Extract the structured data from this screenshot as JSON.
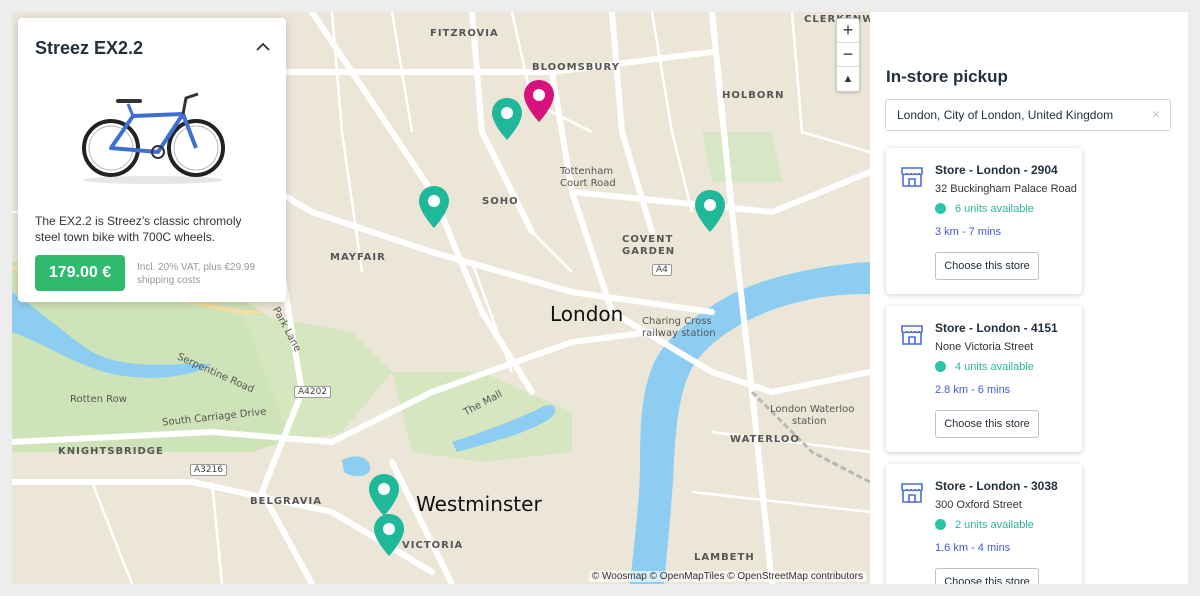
{
  "product": {
    "title": "Streez EX2.2",
    "description": "The EX2.2 is Streez’s classic chromoly steel town bike with 700C wheels.",
    "price": "179.00 €",
    "price_note": "Incl. 20% VAT, plus €29.99 shipping costs",
    "collapse_icon": "chevron-up-icon"
  },
  "map": {
    "zoom_in": "+",
    "zoom_out": "−",
    "reset_north": "▲",
    "attribution": "© Woosmap © OpenMapTiles © OpenStreetMap contributors",
    "labels": {
      "fitzrovia": "FITZROVIA",
      "bloomsbury": "BLOOMSBURY",
      "holborn": "HOLBORN",
      "clerkenwell": "CLERKENWELL",
      "soho": "SOHO",
      "mayfair": "MAYFAIR",
      "covent_garden_1": "COVENT",
      "covent_garden_2": "GARDEN",
      "tottenham_1": "Tottenham",
      "tottenham_2": "Court Road",
      "london": "London",
      "charing_1": "Charing Cross",
      "charing_2": "railway station",
      "park_lane": "Park Lane",
      "serpentine": "Serpentine Road",
      "rotten_row": "Rotten Row",
      "south_carriage": "South Carriage Drive",
      "the_mall": "The Mall",
      "knightsbridge": "KNIGHTSBRIDGE",
      "belgravia": "BELGRAVIA",
      "westminster": "Westminster",
      "victoria": "VICTORIA",
      "lambeth": "LAMBETH",
      "waterloo": "WATERLOO",
      "waterloo_st_1": "London Waterloo",
      "waterloo_st_2": "station",
      "a4": "A4",
      "a4202": "A4202",
      "a3216": "A3216"
    },
    "pin_colors": {
      "store": "#1fb99a",
      "selected": "#d6127f"
    }
  },
  "pickup": {
    "title": "In-store pickup",
    "search_value": "London, City of London, United Kingdom",
    "clear_label": "×",
    "stores": [
      {
        "name": "Store - London - 2904",
        "address": "32 Buckingham Palace Road",
        "stock": "6 units available",
        "distance": "3 km - 7 mins",
        "button": "Choose this store"
      },
      {
        "name": "Store - London - 4151",
        "address": "None Victoria Street",
        "stock": "4 units available",
        "distance": "2.8 km - 6 mins",
        "button": "Choose this store"
      },
      {
        "name": "Store - London - 3038",
        "address": "300 Oxford Street",
        "stock": "2 units available",
        "distance": "1.6 km - 4 mins",
        "button": "Choose this store"
      }
    ]
  }
}
